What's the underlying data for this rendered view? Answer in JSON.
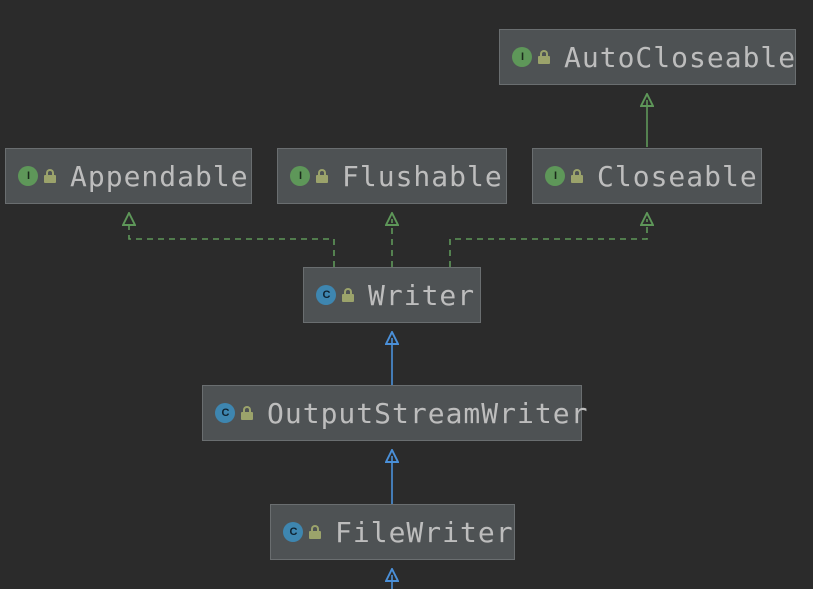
{
  "diagram": {
    "type": "class-hierarchy",
    "nodes": {
      "autocloseable": {
        "kind": "interface",
        "kind_letter": "I",
        "name": "AutoCloseable"
      },
      "appendable": {
        "kind": "interface",
        "kind_letter": "I",
        "name": "Appendable"
      },
      "flushable": {
        "kind": "interface",
        "kind_letter": "I",
        "name": "Flushable"
      },
      "closeable": {
        "kind": "interface",
        "kind_letter": "I",
        "name": "Closeable"
      },
      "writer": {
        "kind": "abstract-class",
        "kind_letter": "C",
        "name": "Writer"
      },
      "osw": {
        "kind": "class",
        "kind_letter": "C",
        "name": "OutputStreamWriter"
      },
      "filewriter": {
        "kind": "class",
        "kind_letter": "C",
        "name": "FileWriter"
      }
    },
    "edges": [
      {
        "from": "closeable",
        "to": "autocloseable",
        "style": "solid",
        "meaning": "extends"
      },
      {
        "from": "writer",
        "to": "appendable",
        "style": "dashed",
        "meaning": "implements"
      },
      {
        "from": "writer",
        "to": "flushable",
        "style": "dashed",
        "meaning": "implements"
      },
      {
        "from": "writer",
        "to": "closeable",
        "style": "dashed",
        "meaning": "implements"
      },
      {
        "from": "osw",
        "to": "writer",
        "style": "solid",
        "meaning": "extends"
      },
      {
        "from": "filewriter",
        "to": "osw",
        "style": "solid",
        "meaning": "extends"
      }
    ],
    "colors": {
      "background": "#2B2B2B",
      "node_fill": "#4E5254",
      "node_border": "#6A6E70",
      "interface_badge": "#5E9759",
      "class_badge": "#3E86B0",
      "extends_edge": "#4A90D9",
      "implements_edge": "#5E9759",
      "interface_extends_edge": "#5E9759",
      "text": "#BDBDBD",
      "lock_icon": "#9BA36B"
    }
  }
}
